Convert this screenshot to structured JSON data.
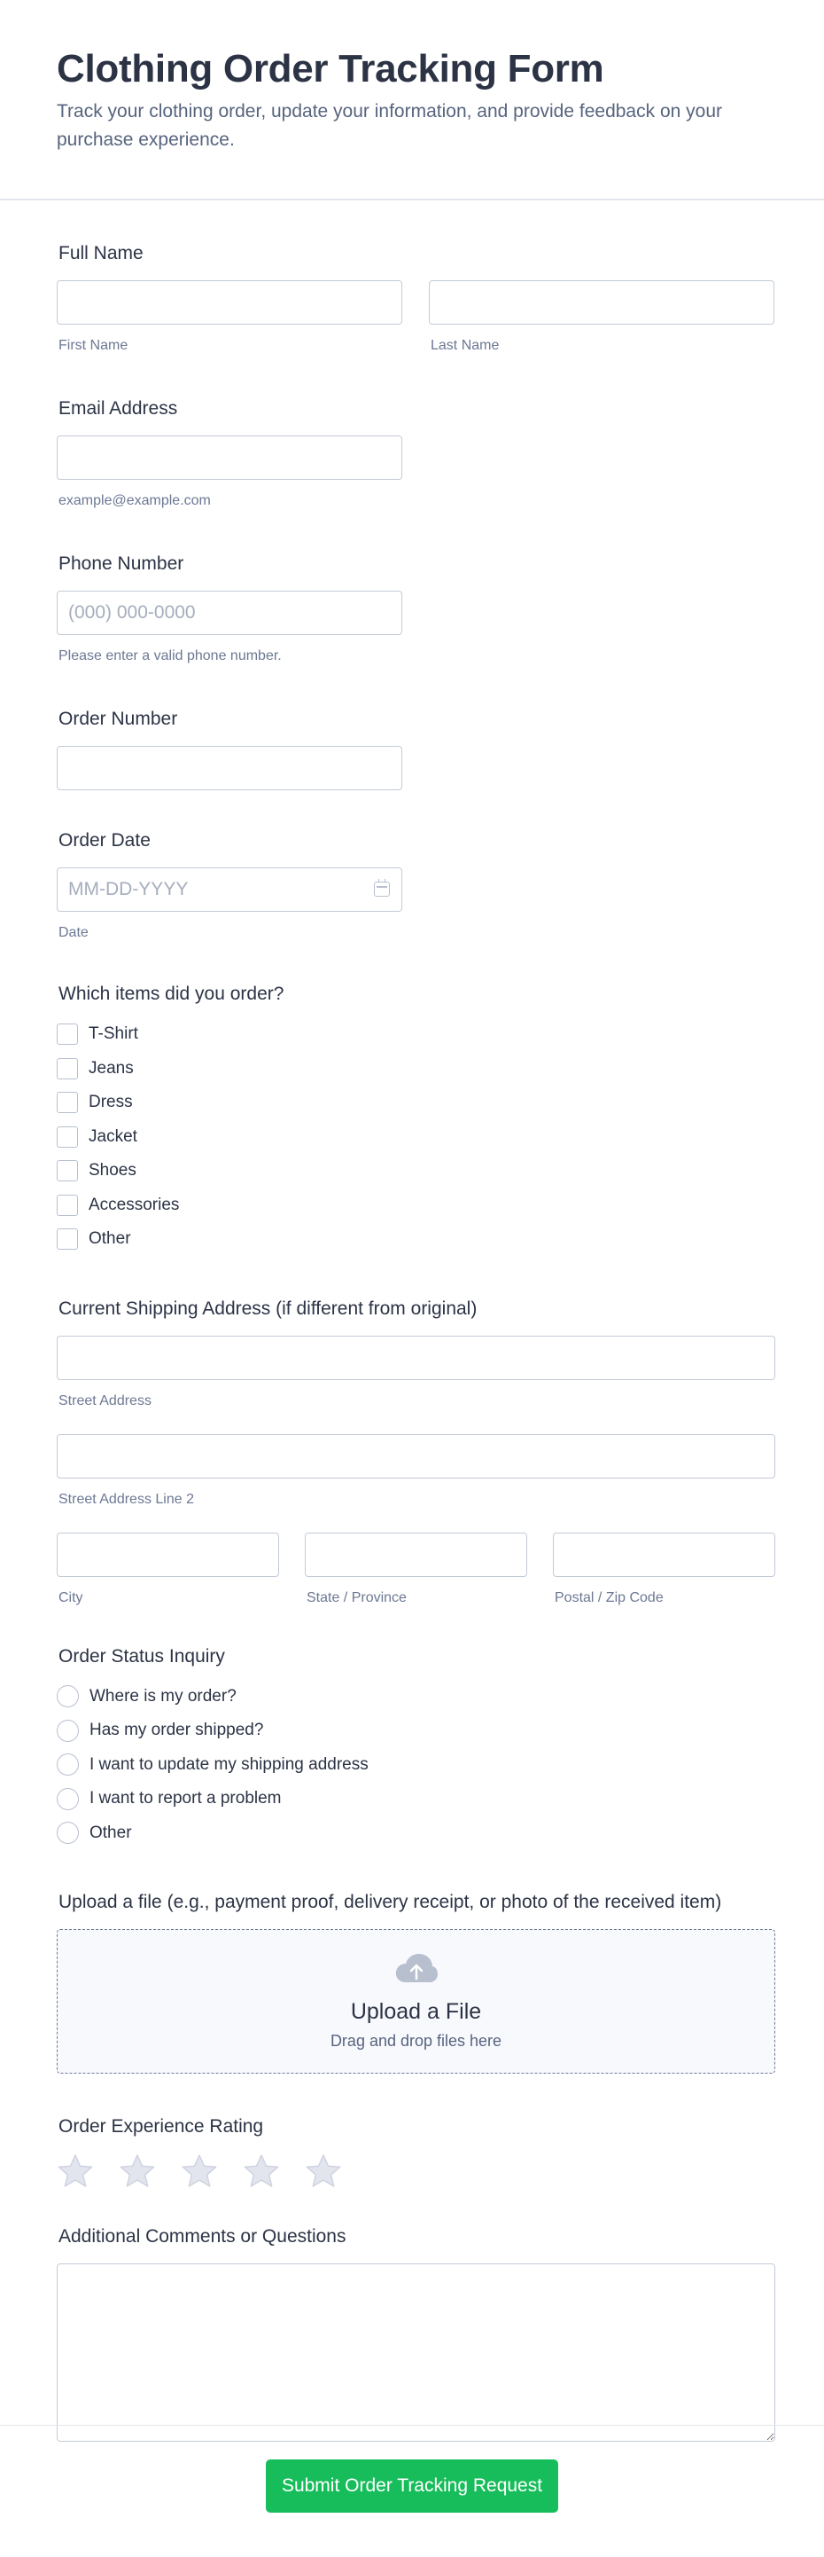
{
  "header": {
    "title": "Clothing Order Tracking Form",
    "subtitle": "Track your clothing order, update your information, and provide feedback on your purchase experience."
  },
  "full_name": {
    "label": "Full Name",
    "first_value": "",
    "last_value": "",
    "first_sub": "First Name",
    "last_sub": "Last Name"
  },
  "email": {
    "label": "Email Address",
    "value": "",
    "sub": "example@example.com"
  },
  "phone": {
    "label": "Phone Number",
    "placeholder": "(000) 000-0000",
    "sub": "Please enter a valid phone number."
  },
  "order_number": {
    "label": "Order Number",
    "value": ""
  },
  "order_date": {
    "label": "Order Date",
    "placeholder": "MM-DD-YYYY",
    "sub": "Date",
    "icon": "calendar-icon"
  },
  "items": {
    "label": "Which items did you order?",
    "options": [
      "T-Shirt",
      "Jeans",
      "Dress",
      "Jacket",
      "Shoes",
      "Accessories",
      "Other"
    ]
  },
  "address": {
    "label": "Current Shipping Address (if different from original)",
    "street_sub": "Street Address",
    "street2_sub": "Street Address Line 2",
    "city_sub": "City",
    "state_sub": "State / Province",
    "zip_sub": "Postal / Zip Code"
  },
  "inquiry": {
    "label": "Order Status Inquiry",
    "options": [
      "Where is my order?",
      "Has my order shipped?",
      "I want to update my shipping address",
      "I want to report a problem",
      "Other"
    ]
  },
  "upload": {
    "label": "Upload a file (e.g., payment proof, delivery receipt, or photo of the received item)",
    "title": "Upload a File",
    "sub": "Drag and drop files here",
    "icon": "cloud-upload-icon"
  },
  "rating": {
    "label": "Order Experience Rating",
    "max": 5,
    "value": 0,
    "icon": "star-icon"
  },
  "comments": {
    "label": "Additional Comments or Questions",
    "value": ""
  },
  "submit": {
    "label": "Submit Order Tracking Request"
  },
  "colors": {
    "submit_bg": "#18bd5b",
    "text": "#2c3345",
    "sub_text": "#6c7893",
    "border": "#c3cad8",
    "star": "#e3e5ee"
  }
}
